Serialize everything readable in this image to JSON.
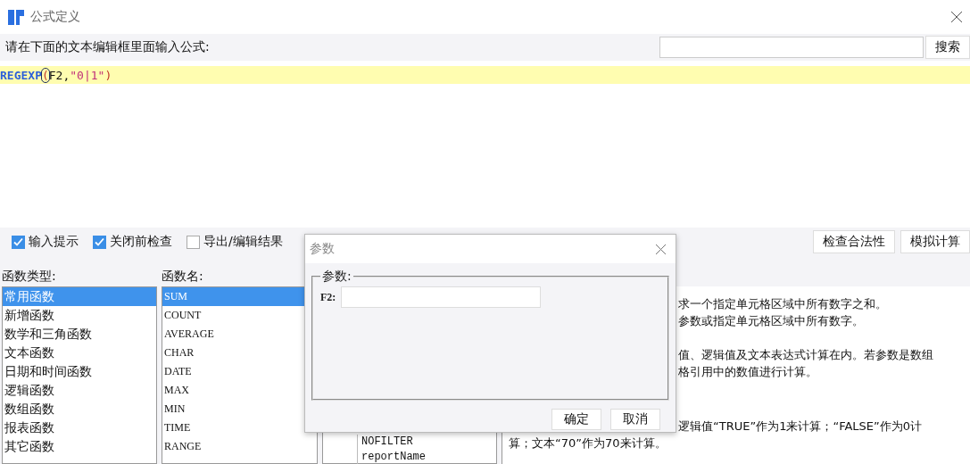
{
  "window": {
    "title": "公式定义"
  },
  "prompt": "请在下面的文本编辑框里面输入公式:",
  "search": {
    "button": "搜索"
  },
  "formula": [
    {
      "kind": "function",
      "text": "REGEXP"
    },
    {
      "kind": "cursor",
      "text": "("
    },
    {
      "kind": "plain",
      "text": "F2,"
    },
    {
      "kind": "string",
      "text": "\"0|1\""
    },
    {
      "kind": "paren",
      "text": ")"
    }
  ],
  "options": [
    {
      "label": "输入提示",
      "checked": true
    },
    {
      "label": "关闭前检查",
      "checked": true
    },
    {
      "label": "导出/编辑结果",
      "checked": false
    }
  ],
  "actions": [
    "检查合法性",
    "模拟计算"
  ],
  "function_types": {
    "label": "函数类型:",
    "items": [
      {
        "label": "常用函数",
        "selected": true
      },
      {
        "label": "新增函数",
        "selected": false
      },
      {
        "label": "数学和三角函数",
        "selected": false
      },
      {
        "label": "文本函数",
        "selected": false
      },
      {
        "label": "日期和时间函数",
        "selected": false
      },
      {
        "label": "逻辑函数",
        "selected": false
      },
      {
        "label": "数组函数",
        "selected": false
      },
      {
        "label": "报表函数",
        "selected": false
      },
      {
        "label": "其它函数",
        "selected": false
      }
    ]
  },
  "function_names": {
    "label": "函数名:",
    "items": [
      {
        "label": "SUM",
        "selected": true
      },
      {
        "label": "COUNT",
        "selected": false
      },
      {
        "label": "AVERAGE",
        "selected": false
      },
      {
        "label": "CHAR",
        "selected": false
      },
      {
        "label": "DATE",
        "selected": false
      },
      {
        "label": "MAX",
        "selected": false
      },
      {
        "label": "MIN",
        "selected": false
      },
      {
        "label": "TIME",
        "selected": false
      },
      {
        "label": "RANGE",
        "selected": false
      }
    ]
  },
  "tree": {
    "items": [
      "NOFILTER",
      "reportName"
    ]
  },
  "description": [
    [
      "求一个指定单元格区域中所有数字之和。",
      "参数或指定单元格区域中所有数字。"
    ],
    [
      "值、逻辑值及文本表达式计算在内。若参数是数组",
      "格引用中的数值进行计算。"
    ],
    [
      "逻辑值“TRUE”作为1来计算；“FALSE”作为0计",
      "算；文本“70”作为70来计算。"
    ]
  ],
  "dialog": {
    "title": "参数",
    "group": "参数:",
    "fields": [
      {
        "label": "F2:"
      }
    ],
    "buttons": [
      "确定",
      "取消"
    ]
  }
}
